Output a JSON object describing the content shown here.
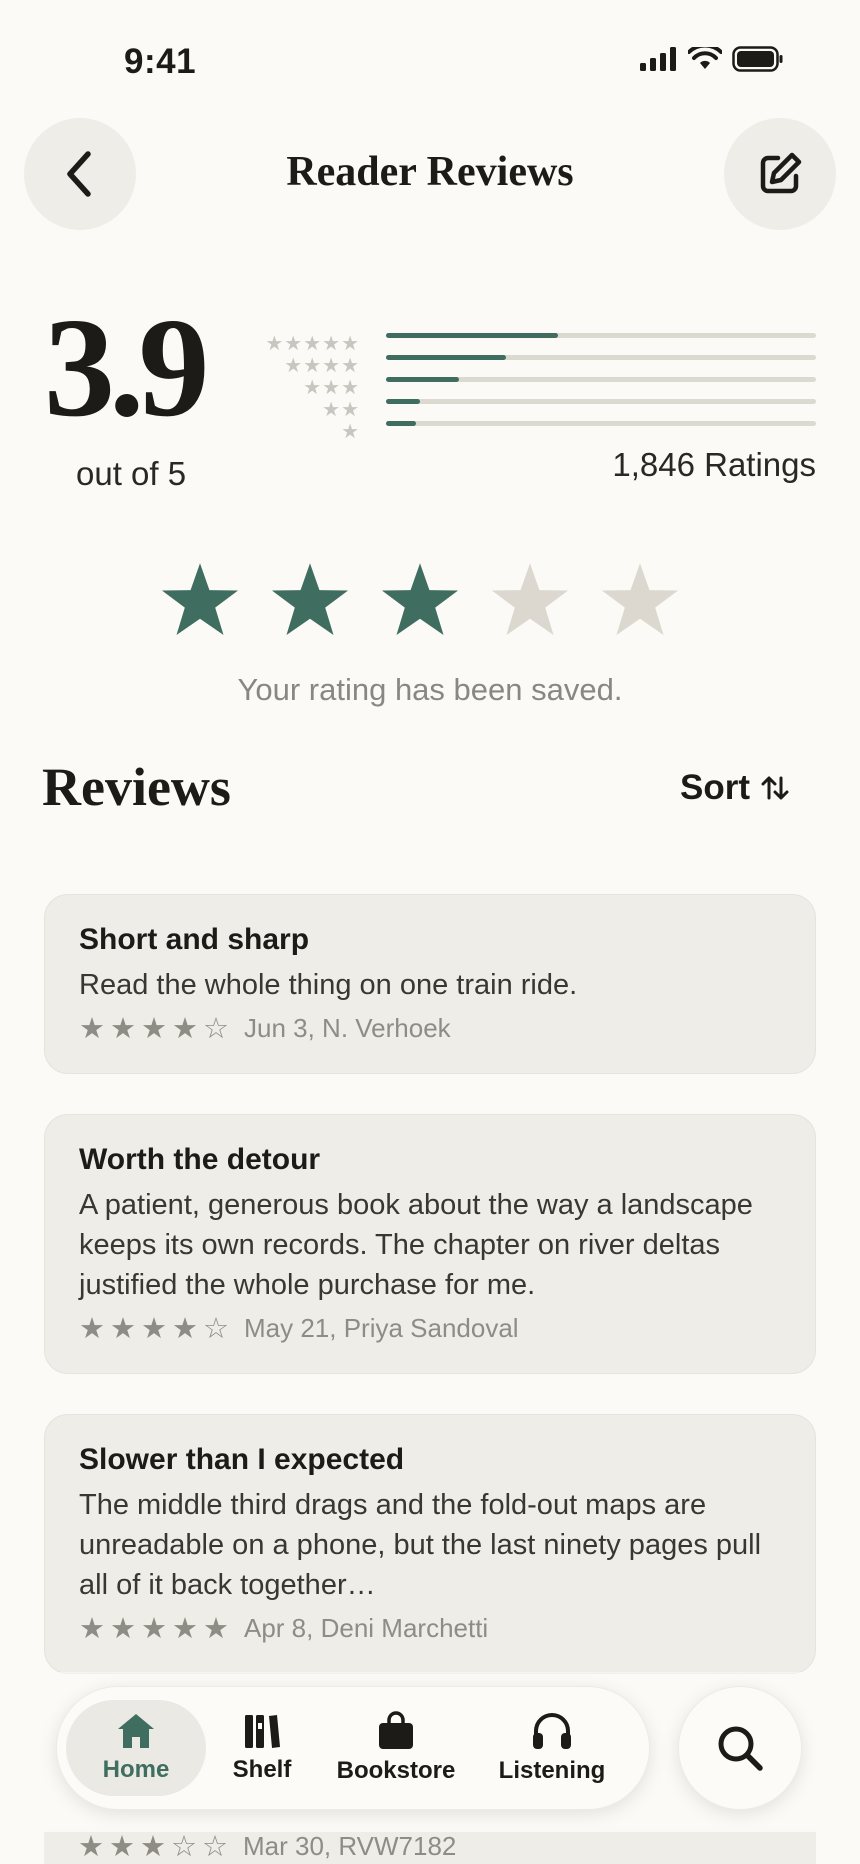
{
  "status_bar": {
    "time": "9:41"
  },
  "header": {
    "title": "Reader Reviews"
  },
  "summary": {
    "average": "3.9",
    "out_of": "out of 5",
    "ratings_count": "1,846 Ratings",
    "distribution": [
      {
        "stars": 5,
        "fraction": 0.4
      },
      {
        "stars": 4,
        "fraction": 0.28
      },
      {
        "stars": 3,
        "fraction": 0.17
      },
      {
        "stars": 2,
        "fraction": 0.08
      },
      {
        "stars": 1,
        "fraction": 0.07
      }
    ]
  },
  "user_rating": {
    "value": 3,
    "max": 5,
    "message": "Your rating has been saved."
  },
  "reviews_section": {
    "heading": "Reviews",
    "sort_label": "Sort"
  },
  "reviews": [
    {
      "title": "Short and sharp",
      "body": "Read the whole thing on one train ride.",
      "stars": "★★★★☆",
      "meta": "Jun 3, N. Verhoek"
    },
    {
      "title": "Worth the detour",
      "body": "A patient, generous book about the way a landscape keeps its own records. The chapter on river deltas justified the whole purchase for me.",
      "stars": "★★★★☆",
      "meta": "May 21, Priya Sandoval"
    },
    {
      "title": "Slower than I expected",
      "body": "The middle third drags and the fold-out maps are unreadable on a phone, but the last ninety pages pull all of it back together…",
      "stars": "★★★★★",
      "meta": "Apr 8, Deni Marchetti"
    }
  ],
  "peek_review": {
    "stars": "★★★☆☆",
    "meta": "Mar 30, RVW7182"
  },
  "tabbar": {
    "tabs": [
      {
        "label": "Home",
        "icon": "home-icon",
        "active": true
      },
      {
        "label": "Shelf",
        "icon": "shelf-icon"
      },
      {
        "label": "Bookstore",
        "icon": "bag-icon"
      },
      {
        "label": "Listening",
        "icon": "headphones-icon"
      }
    ],
    "search_icon": "search-icon"
  },
  "colors": {
    "accent": "#3f6e61",
    "star_empty": "#dcd8cf",
    "background": "#fbfaf7",
    "card": "#efede7"
  }
}
